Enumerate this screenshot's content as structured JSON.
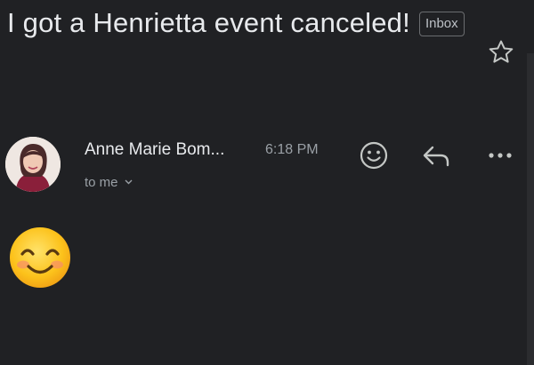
{
  "email": {
    "subject": "I got a Henrietta event canceled!",
    "label": "Inbox",
    "sender_name": "Anne Marie Bom...",
    "time": "6:18 PM",
    "recipient": "to me",
    "body_emoji": "smiling-face-with-smiling-eyes"
  },
  "icons": {
    "star": "star-icon",
    "react": "smiley-icon",
    "reply": "reply-icon",
    "more": "more-vert-icon",
    "expand": "chevron-down-icon"
  },
  "colors": {
    "background": "#202124",
    "primary_text": "#e8eaed",
    "secondary_text": "#9aa0a6",
    "emoji_yellow": "#fcc21b"
  }
}
